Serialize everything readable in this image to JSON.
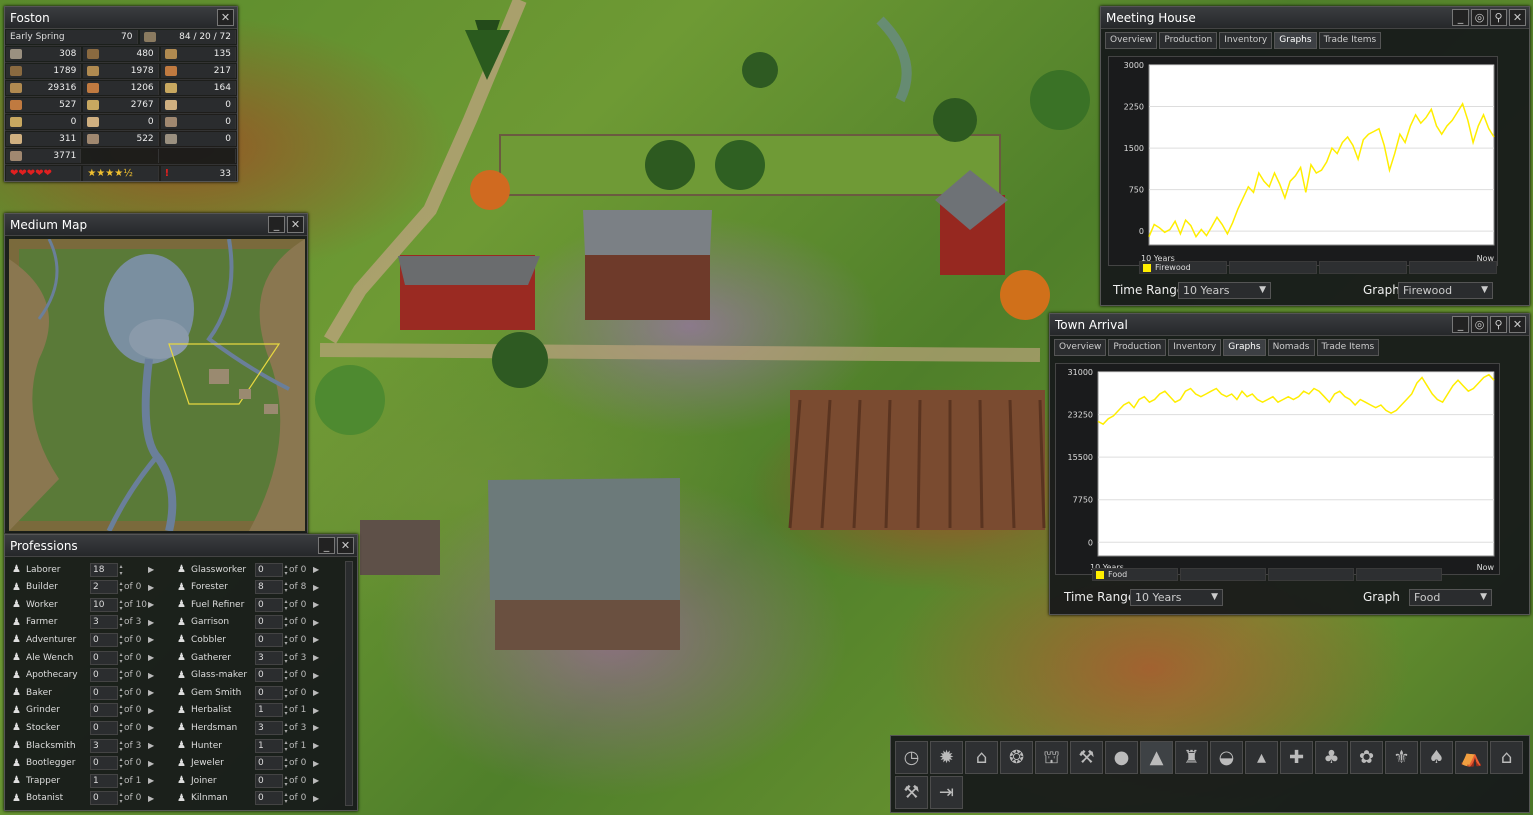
{
  "town": {
    "name": "Foston",
    "season": "Early Spring",
    "year": "70",
    "pop": "84 / 20 / 72",
    "resources": [
      [
        "308",
        "480",
        "135"
      ],
      [
        "1789",
        "1978",
        "217"
      ],
      [
        "29316",
        "1206",
        "164"
      ],
      [
        "527",
        "2767",
        "0"
      ],
      [
        "0",
        "0",
        "0"
      ],
      [
        "311",
        "522",
        "0"
      ],
      [
        "3771",
        "",
        ""
      ]
    ],
    "hearts": "❤❤❤❤❤",
    "stars": "★★★★½",
    "alert": "!",
    "alert_count": "33"
  },
  "minimap": {
    "title": "Medium Map"
  },
  "professions": {
    "title": "Professions",
    "left": [
      [
        "Laborer",
        "18",
        "",
        ""
      ],
      [
        "Builder",
        "2",
        "of",
        "0"
      ],
      [
        "Worker",
        "10",
        "of",
        "10"
      ],
      [
        "Farmer",
        "3",
        "of",
        "3"
      ],
      [
        "Adventurer",
        "0",
        "of",
        "0"
      ],
      [
        "Ale Wench",
        "0",
        "of",
        "0"
      ],
      [
        "Apothecary",
        "0",
        "of",
        "0"
      ],
      [
        "Baker",
        "0",
        "of",
        "0"
      ],
      [
        "Grinder",
        "0",
        "of",
        "0"
      ],
      [
        "Stocker",
        "0",
        "of",
        "0"
      ],
      [
        "Blacksmith",
        "3",
        "of",
        "3"
      ],
      [
        "Bootlegger",
        "0",
        "of",
        "0"
      ],
      [
        "Trapper",
        "1",
        "of",
        "1"
      ],
      [
        "Botanist",
        "0",
        "of",
        "0"
      ]
    ],
    "right": [
      [
        "Glassworker",
        "0",
        "of",
        "0"
      ],
      [
        "Forester",
        "8",
        "of",
        "8"
      ],
      [
        "Fuel Refiner",
        "0",
        "of",
        "0"
      ],
      [
        "Garrison",
        "0",
        "of",
        "0"
      ],
      [
        "Cobbler",
        "0",
        "of",
        "0"
      ],
      [
        "Gatherer",
        "3",
        "of",
        "3"
      ],
      [
        "Glass-maker",
        "0",
        "of",
        "0"
      ],
      [
        "Gem Smith",
        "0",
        "of",
        "0"
      ],
      [
        "Herbalist",
        "1",
        "of",
        "1"
      ],
      [
        "Herdsman",
        "3",
        "of",
        "3"
      ],
      [
        "Hunter",
        "1",
        "of",
        "1"
      ],
      [
        "Jeweler",
        "0",
        "of",
        "0"
      ],
      [
        "Joiner",
        "0",
        "of",
        "0"
      ],
      [
        "Kilnman",
        "0",
        "of",
        "0"
      ]
    ]
  },
  "meeting": {
    "title": "Meeting House",
    "tabs": [
      "Overview",
      "Production",
      "Inventory",
      "Graphs",
      "Trade Items"
    ],
    "active_tab": "Graphs",
    "time_range_label": "Time Range",
    "time_range_value": "10 Years",
    "graph_label": "Graph",
    "graph_value": "Firewood",
    "x_start": "10 Years",
    "x_end": "Now",
    "legend": "Firewood",
    "color": "#ffee00"
  },
  "arrival": {
    "title": "Town Arrival",
    "tabs": [
      "Overview",
      "Production",
      "Inventory",
      "Graphs",
      "Nomads",
      "Trade Items"
    ],
    "active_tab": "Graphs",
    "time_range_label": "Time Range",
    "time_range_value": "10 Years",
    "graph_label": "Graph",
    "graph_value": "Food",
    "x_start": "10 Years",
    "x_end": "Now",
    "legend": "Food",
    "color": "#ffee00"
  },
  "chart_data": [
    {
      "type": "line",
      "yticks": [
        "3000",
        "2250",
        "1500",
        "750",
        "0"
      ],
      "ylim": [
        -250,
        3000
      ],
      "xlabel_start": "10 Years",
      "xlabel_end": "Now",
      "series": [
        {
          "name": "Firewood",
          "values": [
            -100,
            120,
            60,
            -20,
            30,
            180,
            -50,
            200,
            100,
            -100,
            30,
            -80,
            80,
            250,
            120,
            -50,
            150,
            400,
            600,
            800,
            700,
            1050,
            900,
            800,
            1050,
            850,
            600,
            900,
            1000,
            1150,
            700,
            1200,
            1050,
            1100,
            1250,
            1500,
            1400,
            1600,
            1700,
            1550,
            1300,
            1650,
            1750,
            1800,
            1850,
            1550,
            1100,
            1400,
            1750,
            1600,
            1900,
            2100,
            1950,
            2050,
            2200,
            1900,
            1750,
            1900,
            2000,
            2150,
            2300,
            2000,
            1600,
            1900,
            2100,
            1850,
            1700
          ]
        }
      ]
    },
    {
      "type": "line",
      "yticks": [
        "31000",
        "23250",
        "15500",
        "7750",
        "0"
      ],
      "ylim": [
        -2500,
        31000
      ],
      "xlabel_start": "10 Years",
      "xlabel_end": "Now",
      "series": [
        {
          "name": "Food",
          "values": [
            22000,
            21500,
            22500,
            23000,
            24000,
            25000,
            25500,
            24500,
            26000,
            26500,
            25500,
            26000,
            27000,
            27500,
            26500,
            25500,
            26000,
            27500,
            28000,
            27000,
            26500,
            27000,
            27500,
            28000,
            27000,
            26500,
            27000,
            26000,
            27500,
            26500,
            27000,
            26000,
            25500,
            26000,
            26500,
            25500,
            26000,
            26500,
            26000,
            26500,
            27500,
            27000,
            28000,
            27500,
            26500,
            25500,
            27000,
            27500,
            26500,
            26000,
            25000,
            26000,
            25500,
            25000,
            24500,
            25000,
            24000,
            23500,
            24000,
            25000,
            26000,
            27000,
            29000,
            30000,
            28500,
            27000,
            26000,
            25500,
            27000,
            28500,
            29500,
            28500,
            27500,
            28000,
            29000,
            30000,
            30500,
            29500
          ]
        }
      ]
    }
  ],
  "toolbar": {
    "icons": [
      "clock-icon",
      "gear-icon",
      "house-icon",
      "wheel-icon",
      "barn-icon",
      "hammer-icon",
      "apple-icon",
      "tree-icon",
      "factory-icon",
      "pot-icon",
      "well-icon",
      "cross-tools-icon",
      "plant-icon",
      "berries-icon",
      "fleur-icon",
      "oak-icon",
      "tent-icon",
      "stable-icon"
    ],
    "glyphs": [
      "◷",
      "✹",
      "⌂",
      "❂",
      "⛫",
      "⚒",
      "●",
      "▲",
      "♜",
      "◒",
      "▴",
      "✚",
      "♣",
      "✿",
      "⚜",
      "♠",
      "⛺",
      "⌂"
    ],
    "icons2": [
      "build-tool-icon",
      "exit-icon"
    ],
    "glyphs2": [
      "⚒",
      "⇥"
    ]
  }
}
